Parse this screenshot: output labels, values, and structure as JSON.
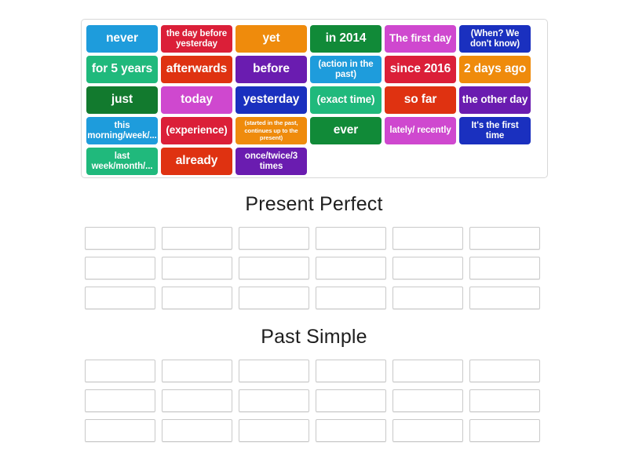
{
  "word_bank": {
    "rows": [
      [
        {
          "label": "never",
          "color": "#1E9CDC",
          "size": "fs-lg"
        },
        {
          "label": "the day before yesterday",
          "color": "#DB1F38",
          "size": "fs-sm"
        },
        {
          "label": "yet",
          "color": "#EF8B0C",
          "size": "fs-lg"
        },
        {
          "label": "in 2014",
          "color": "#118A38",
          "size": "fs-lg"
        },
        {
          "label": "The first day",
          "color": "#CF48CF",
          "size": "fs-md"
        },
        {
          "label": "(When? We don't know)",
          "color": "#1A30BF",
          "size": "fs-sm"
        }
      ],
      [
        {
          "label": "for 5 years",
          "color": "#20B97C",
          "size": "fs-lg"
        },
        {
          "label": "afterwards",
          "color": "#DF3211",
          "size": "fs-lg"
        },
        {
          "label": "before",
          "color": "#6A1CB0",
          "size": "fs-lg"
        },
        {
          "label": "(action in the past)",
          "color": "#1E9CDC",
          "size": "fs-sm"
        },
        {
          "label": "since 2016",
          "color": "#DB1F38",
          "size": "fs-lg"
        },
        {
          "label": "2 days ago",
          "color": "#EF8B0C",
          "size": "fs-lg"
        }
      ],
      [
        {
          "label": "just",
          "color": "#127A2E",
          "size": "fs-lg"
        },
        {
          "label": "today",
          "color": "#CF48CF",
          "size": "fs-lg"
        },
        {
          "label": "yesterday",
          "color": "#1A30BF",
          "size": "fs-lg"
        },
        {
          "label": "(exact time)",
          "color": "#20B97C",
          "size": "fs-md"
        },
        {
          "label": "so far",
          "color": "#DF3211",
          "size": "fs-lg"
        },
        {
          "label": "the other day",
          "color": "#6A1CB0",
          "size": "fs-md"
        }
      ],
      [
        {
          "label": "this morning/week/...",
          "color": "#1E9CDC",
          "size": "fs-sm"
        },
        {
          "label": "(experience)",
          "color": "#DB1F38",
          "size": "fs-md"
        },
        {
          "label": "(started in the past, continues up to the present)",
          "color": "#EF8B0C",
          "size": "fs-xs"
        },
        {
          "label": "ever",
          "color": "#118A38",
          "size": "fs-lg"
        },
        {
          "label": "lately/ recently",
          "color": "#CF48CF",
          "size": "fs-sm"
        },
        {
          "label": "It's the first time",
          "color": "#1A30BF",
          "size": "fs-sm"
        }
      ],
      [
        {
          "label": "last week/month/...",
          "color": "#20B97C",
          "size": "fs-sm"
        },
        {
          "label": "already",
          "color": "#DF3211",
          "size": "fs-lg"
        },
        {
          "label": "once/twice/3 times",
          "color": "#6A1CB0",
          "size": "fs-sm"
        }
      ]
    ]
  },
  "categories": [
    {
      "title": "Present Perfect",
      "rows": 3,
      "columns": 6
    },
    {
      "title": "Past Simple",
      "rows": 3,
      "columns": 6
    }
  ]
}
